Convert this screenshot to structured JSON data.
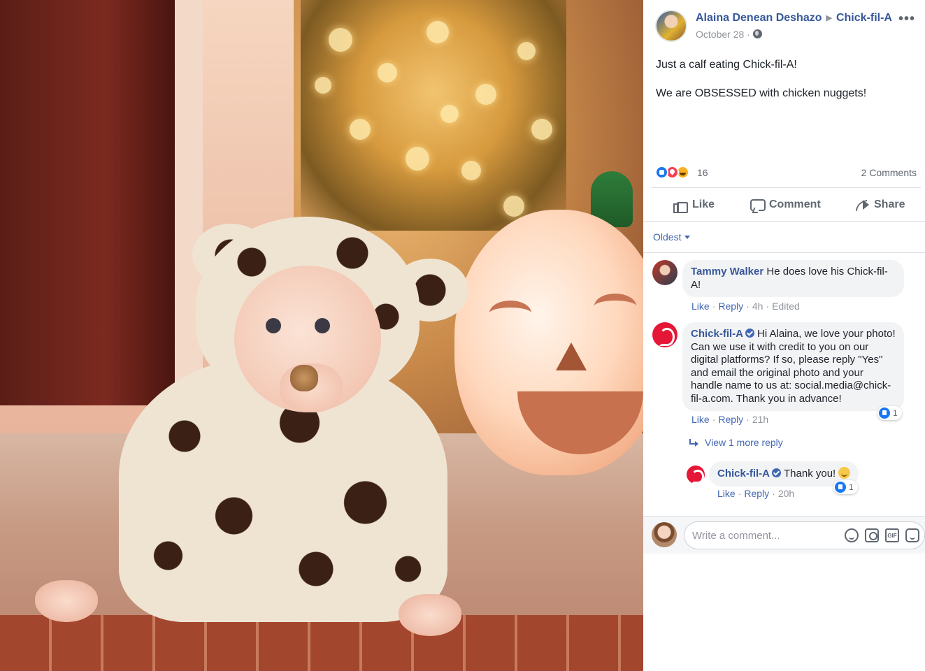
{
  "post": {
    "author": "Alaina Denean Deshazo",
    "page": "Chick-fil-A",
    "date": "October 28",
    "date_separator": "·",
    "text_line1": "Just a calf eating Chick-fil-A!",
    "text_line2": "We are OBSESSED with chicken nuggets!",
    "reaction_count": "16",
    "comment_count": "2 Comments",
    "reaction_types": [
      "like-icon",
      "love-icon",
      "haha-icon"
    ]
  },
  "actions": {
    "like": "Like",
    "comment": "Comment",
    "share": "Share"
  },
  "sort": {
    "label": "Oldest"
  },
  "comments": [
    {
      "name": "Tammy Walker",
      "text": "He does love his Chick-fil-A!",
      "like": "Like",
      "reply": "Reply",
      "time": "4h",
      "edited": "Edited"
    },
    {
      "name": "Chick-fil-A",
      "verified": true,
      "text": "Hi Alaina, we love your photo! Can we use it with credit to you on our digital platforms? If so, please reply \"Yes\" and email the original photo and your handle name to us at: social.media@chick-fil-a.com. Thank you in advance!",
      "like": "Like",
      "reply": "Reply",
      "time": "21h",
      "reaction_count": "1"
    }
  ],
  "view_more": "View 1 more reply",
  "reply": {
    "name": "Chick-fil-A",
    "verified": true,
    "text": "Thank you!",
    "like": "Like",
    "reply": "Reply",
    "time": "20h",
    "reaction_count": "1"
  },
  "composer": {
    "placeholder": "Write a comment...",
    "gif_label": "GIF"
  },
  "colors": {
    "link": "#365899",
    "action_link": "#4267b2",
    "muted": "#90949c",
    "bubble": "#f2f3f5",
    "brand_red": "#e51636"
  }
}
